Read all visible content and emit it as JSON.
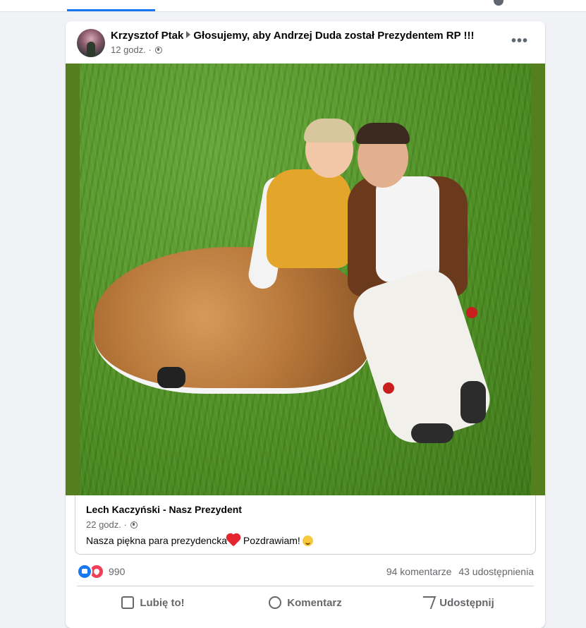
{
  "post": {
    "author": "Krzysztof Ptak",
    "group": "Głosujemy, aby Andrzej Duda został Prezydentem RP !!!",
    "time": "12 godz. ·",
    "more": "•••"
  },
  "shared_post": {
    "page_name": "Lech Kaczyński - Nasz Prezydent",
    "time": "22 godz. ·",
    "text_before": "Nasza piękna para prezydencka",
    "text_after": " Pozdrawiam!"
  },
  "engagement": {
    "reaction_count": "990",
    "comments": "94 komentarze",
    "shares": "43 udostępnienia"
  },
  "actions": {
    "like": "Lubię to!",
    "comment": "Komentarz",
    "share": "Udostępnij"
  },
  "colors": {
    "accent": "#1877f2",
    "love": "#f33e58"
  }
}
